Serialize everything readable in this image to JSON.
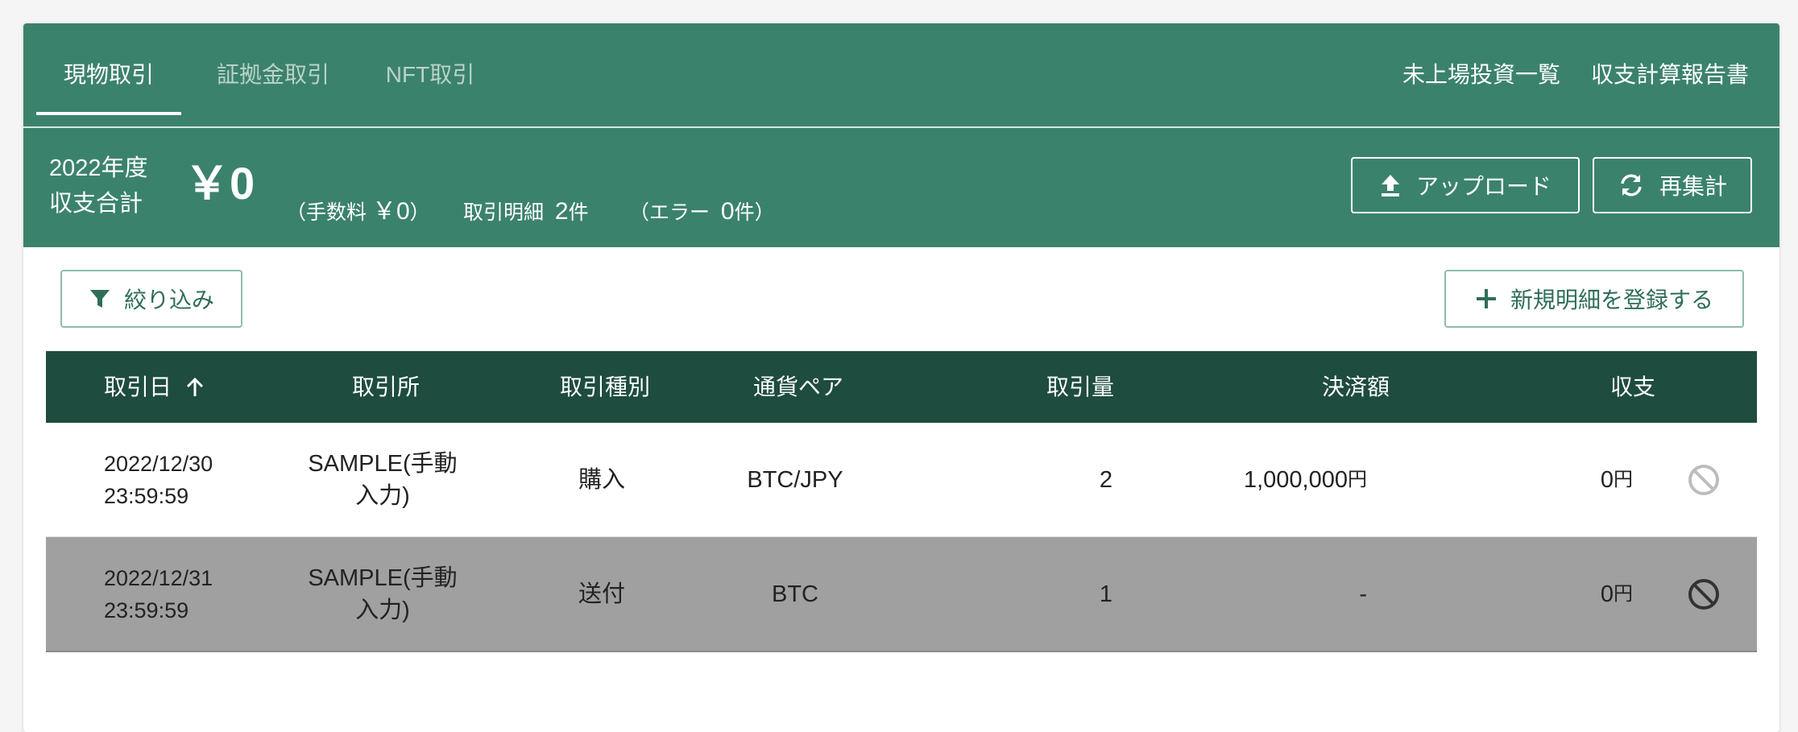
{
  "tabs": {
    "items": [
      {
        "label": "現物取引",
        "active": true
      },
      {
        "label": "証拠金取引",
        "active": false
      },
      {
        "label": "NFT取引",
        "active": false
      }
    ],
    "right_links": [
      {
        "label": "未上場投資一覧"
      },
      {
        "label": "収支計算報告書"
      }
    ]
  },
  "summary": {
    "year_line1": "2022年度",
    "year_line2": "収支合計",
    "total": "￥0",
    "fee_prefix": "（手数料",
    "fee_value": "￥0",
    "fee_suffix": "）",
    "count_label": "取引明細",
    "count_value": "2",
    "count_unit": "件",
    "error_prefix": "（エラー",
    "error_value": "0",
    "error_suffix": "件）",
    "upload_label": "アップロード",
    "recalc_label": "再集計"
  },
  "actions": {
    "filter_label": "絞り込み",
    "new_label": "新規明細を登録する"
  },
  "table": {
    "headers": {
      "date": "取引日",
      "exchange": "取引所",
      "type": "取引種別",
      "pair": "通貨ペア",
      "quantity": "取引量",
      "settlement": "決済額",
      "profit": "収支"
    },
    "rows": [
      {
        "date": "2022/12/30",
        "time": "23:59:59",
        "exchange_line1": "SAMPLE(手動",
        "exchange_line2": "入力)",
        "type": "購入",
        "pair": "BTC/JPY",
        "quantity": "2",
        "settlement": "1,000,000",
        "settlement_unit": "円",
        "profit": "0",
        "profit_unit": "円",
        "excluded": false
      },
      {
        "date": "2022/12/31",
        "time": "23:59:59",
        "exchange_line1": "SAMPLE(手動",
        "exchange_line2": "入力)",
        "type": "送付",
        "pair": "BTC",
        "quantity": "1",
        "settlement": "-",
        "settlement_unit": "",
        "profit": "0",
        "profit_unit": "円",
        "excluded": true
      }
    ]
  },
  "colors": {
    "header_green": "#3b826d",
    "table_header": "#1e4c3f",
    "excluded_row": "#a0a0a0",
    "button_text_green": "#2f6d5a"
  }
}
